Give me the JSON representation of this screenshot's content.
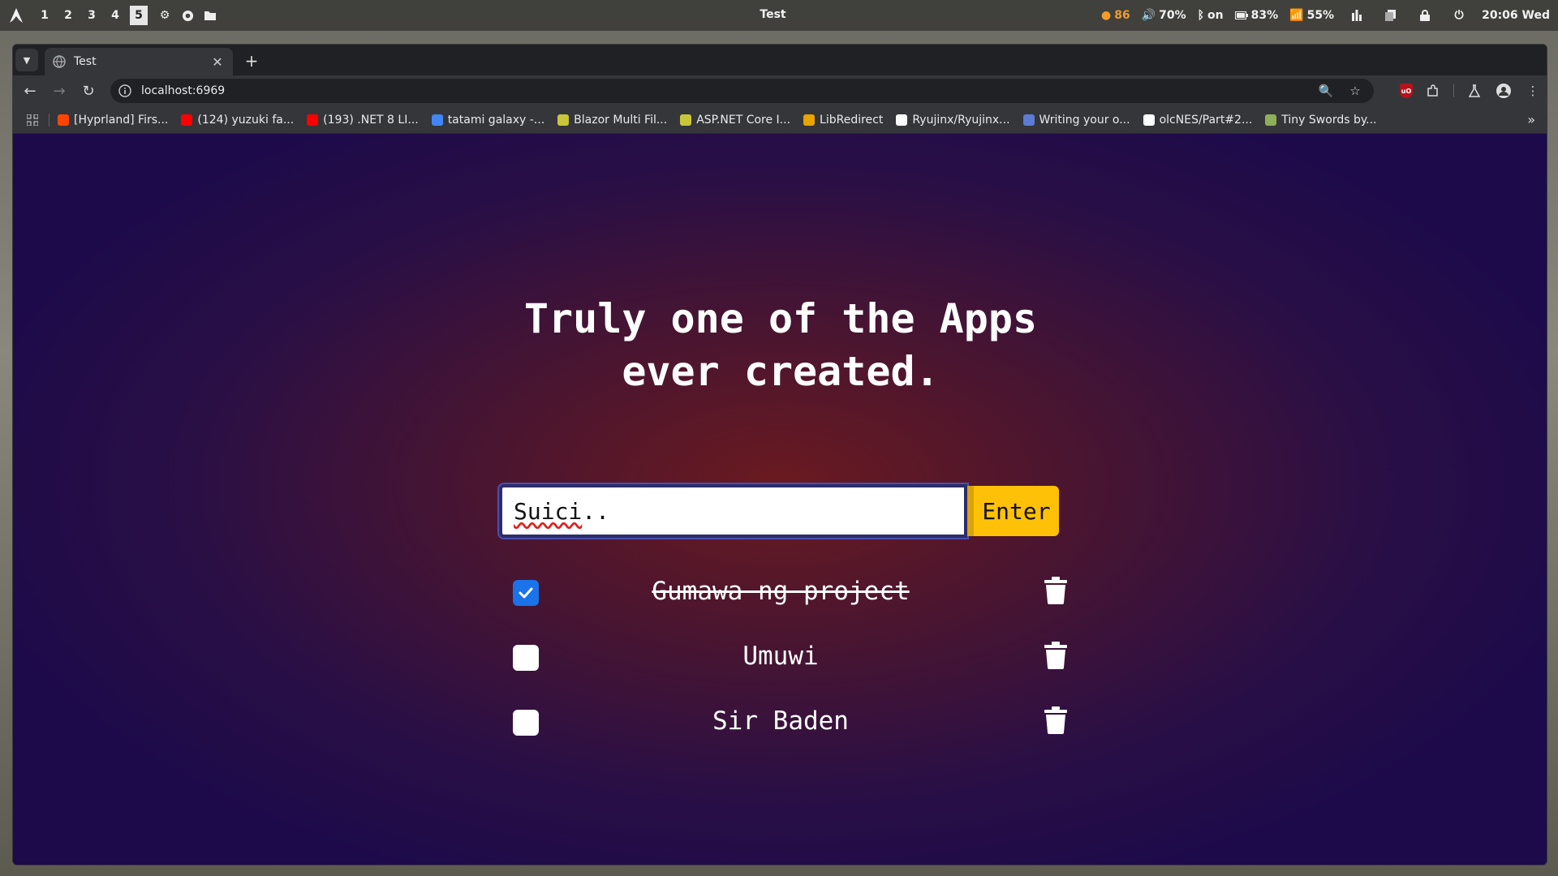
{
  "system_bar": {
    "workspaces": [
      "1",
      "2",
      "3",
      "4",
      "5"
    ],
    "active_workspace": "5",
    "window_title": "Test",
    "battery_badge": "86",
    "volume": "70%",
    "bluetooth": "on",
    "battery": "83%",
    "wifi": "55%",
    "clock": "20:06 Wed"
  },
  "browser": {
    "tab": {
      "title": "Test"
    },
    "url": "localhost:6969",
    "bookmarks": [
      {
        "label": "[Hyprland] Firs...",
        "color": "#ff4500"
      },
      {
        "label": "(124) yuzuki fa...",
        "color": "#ff0000"
      },
      {
        "label": "(193) .NET 8 LI...",
        "color": "#ff0000"
      },
      {
        "label": "tatami galaxy -...",
        "color": "#4285f4"
      },
      {
        "label": "Blazor Multi Fil...",
        "color": "#c9c63a"
      },
      {
        "label": "ASP.NET Core I...",
        "color": "#c9c63a"
      },
      {
        "label": "LibRedirect",
        "color": "#e8a400"
      },
      {
        "label": "Ryujinx/Ryujinx...",
        "color": "#ffffff"
      },
      {
        "label": "Writing your o...",
        "color": "#5b7bd5"
      },
      {
        "label": "olcNES/Part#2...",
        "color": "#ffffff"
      },
      {
        "label": "Tiny Swords by...",
        "color": "#8fae5a"
      }
    ]
  },
  "app": {
    "headline_line1": "Truly one of the Apps",
    "headline_line2": "ever created.",
    "input_value": "Suici",
    "input_trailing": "..",
    "enter_label": "Enter",
    "todos": [
      {
        "label": "Gumawa ng project",
        "done": true
      },
      {
        "label": "Umuwi",
        "done": false
      },
      {
        "label": "Sir Baden",
        "done": false
      }
    ]
  },
  "colors": {
    "enter_button": "#ffc107",
    "checkbox_checked": "#1a73e8"
  }
}
